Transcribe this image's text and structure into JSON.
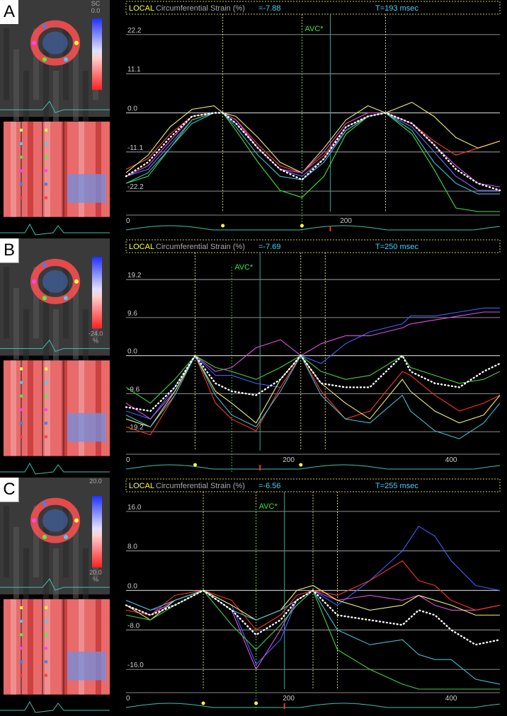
{
  "panels": [
    {
      "label": "A",
      "header": {
        "local": "LOCAL",
        "strain_label": "Circumferential Strain (%)",
        "strain_value": "=-7.88",
        "time_label": "T=193 msec"
      },
      "avc_label": "AVC*",
      "scale_top": "SC\n0.0",
      "chart_data": {
        "type": "line",
        "ylabel": "Circumferential Strain (%)",
        "yticks": [
          22.2,
          11.1,
          0.0,
          -11.1,
          -22.2
        ],
        "ytick_labels": [
          "22.2",
          "11.1",
          "0.0",
          "-11.1",
          "-22.2"
        ],
        "xticks": [
          0,
          200
        ],
        "ylim": [
          -28,
          28
        ],
        "xlim": [
          0,
          340
        ],
        "avc_x": 160,
        "markers_x": [
          88,
          160,
          236
        ],
        "x": [
          0,
          20,
          40,
          60,
          80,
          88,
          100,
          120,
          140,
          160,
          180,
          200,
          220,
          236,
          260,
          280,
          300,
          320,
          340
        ],
        "series": [
          {
            "color": "#7070ff",
            "values": [
              -18,
              -16,
              -9,
              -2,
              0,
              0,
              -3,
              -10,
              -16,
              -18,
              -13,
              -5,
              -1,
              0,
              -4,
              -11,
              -18,
              -22,
              -22
            ]
          },
          {
            "color": "#ff4040",
            "values": [
              -16,
              -13,
              -6,
              -1,
              0,
              0,
              -2,
              -9,
              -15,
              -17,
              -12,
              -4,
              -1,
              0,
              -3,
              -8,
              -12,
              -10,
              -8
            ]
          },
          {
            "color": "#f0f070",
            "values": [
              -17,
              -12,
              -4,
              1,
              2,
              0,
              -1,
              -7,
              -14,
              -17,
              -10,
              -2,
              2,
              0,
              3,
              -1,
              -7,
              -10,
              -8
            ]
          },
          {
            "color": "#40e040",
            "values": [
              -20,
              -18,
              -10,
              -2,
              0,
              0,
              -5,
              -14,
              -22,
              -24,
              -18,
              -6,
              -1,
              0,
              -6,
              -16,
              -27,
              -28,
              -28
            ]
          },
          {
            "color": "#e050e0",
            "values": [
              -18,
              -15,
              -8,
              -1,
              0,
              0,
              -2,
              -10,
              -16,
              -17,
              -11,
              -3,
              0,
              0,
              -3,
              -9,
              -15,
              -20,
              -21
            ]
          },
          {
            "color": "#40c0d0",
            "values": [
              -20,
              -17,
              -10,
              -3,
              0,
              0,
              -4,
              -12,
              -18,
              -19,
              -14,
              -5,
              -1,
              0,
              -5,
              -14,
              -20,
              -23,
              -23
            ]
          },
          {
            "color": "#ffffff",
            "dotted": true,
            "values": [
              -18,
              -14,
              -7,
              -1,
              0,
              0,
              -3,
              -10,
              -16,
              -19,
              -13,
              -4,
              -1,
              0,
              -3,
              -9,
              -16,
              -20,
              -22
            ]
          }
        ]
      }
    },
    {
      "label": "B",
      "header": {
        "local": "LOCAL",
        "strain_label": "Circumferential Strain (%)",
        "strain_value": "=-7.69",
        "time_label": "T=250 msec"
      },
      "avc_label": "AVC*",
      "scale_bottom": "-24.0\n%",
      "chart_data": {
        "type": "line",
        "ylabel": "Circumferential Strain (%)",
        "yticks": [
          19.2,
          9.6,
          0.0,
          -9.6,
          -19.2
        ],
        "ytick_labels": [
          "19.2",
          "9.6",
          "0.0",
          "-9.6",
          "-19.2"
        ],
        "xticks": [
          0,
          200,
          400
        ],
        "ylim": [
          -24,
          26
        ],
        "xlim": [
          0,
          460
        ],
        "avc_x": 130,
        "markers_x": [
          85,
          215,
          245
        ],
        "x": [
          0,
          30,
          60,
          85,
          110,
          130,
          160,
          190,
          215,
          240,
          270,
          300,
          340,
          350,
          380,
          410,
          440,
          460
        ],
        "series": [
          {
            "color": "#4060ff",
            "values": [
              -14,
              -16,
              -8,
              0,
              -5,
              -5,
              -7,
              -8,
              0,
              -2,
              3,
              6,
              8,
              10,
              10,
              11,
              12,
              12
            ]
          },
          {
            "color": "#e050e0",
            "values": [
              -12,
              -16,
              -9,
              0,
              -4,
              -3,
              2,
              4,
              0,
              3,
              5,
              5,
              7,
              8,
              9,
              10,
              11,
              11
            ]
          },
          {
            "color": "#ff3030",
            "values": [
              -18,
              -20,
              -10,
              0,
              -12,
              -16,
              -19,
              -8,
              0,
              -9,
              -16,
              -14,
              -4,
              -5,
              -10,
              -14,
              -12,
              -10
            ]
          },
          {
            "color": "#f0f070",
            "values": [
              -16,
              -18,
              -9,
              0,
              -9,
              -12,
              -17,
              -6,
              0,
              -7,
              -12,
              -16,
              -6,
              -9,
              -14,
              -17,
              -15,
              -10
            ]
          },
          {
            "color": "#40c0d0",
            "values": [
              -15,
              -18,
              -10,
              0,
              -10,
              -15,
              -18,
              -9,
              0,
              -10,
              -16,
              -17,
              -10,
              -14,
              -19,
              -21,
              -17,
              -12
            ]
          },
          {
            "color": "#40d040",
            "values": [
              -8,
              -12,
              -6,
              0,
              -3,
              -4,
              -6,
              -3,
              0,
              -4,
              -6,
              -5,
              0,
              -3,
              -5,
              -7,
              -6,
              -4
            ]
          },
          {
            "color": "#ffffff",
            "dotted": true,
            "values": [
              -13,
              -14,
              -8,
              0,
              -7,
              -9,
              -10,
              -6,
              0,
              -7,
              -8,
              -8,
              0,
              -4,
              -7,
              -8,
              -4,
              -2
            ]
          }
        ]
      }
    },
    {
      "label": "C",
      "header": {
        "local": "LOCAL",
        "strain_label": "Circumferential Strain (%)",
        "strain_value": "=-6.56",
        "time_label": "T=255 msec"
      },
      "avc_label": "AVC*",
      "scale_top": "20.0",
      "scale_bottom": "20.0\n%",
      "chart_data": {
        "type": "line",
        "ylabel": "Circumferential Strain (%)",
        "yticks": [
          16.0,
          8.0,
          0.0,
          -8.0,
          -16.0
        ],
        "ytick_labels": [
          "16.0",
          "8.0",
          "0.0",
          "-8.0",
          "-16.0"
        ],
        "xticks": [
          0,
          200,
          400
        ],
        "ylim": [
          -20,
          20
        ],
        "xlim": [
          0,
          460
        ],
        "avc_x": 160,
        "markers_x": [
          95,
          160,
          230,
          260
        ],
        "x": [
          0,
          30,
          60,
          95,
          130,
          160,
          190,
          210,
          230,
          260,
          300,
          340,
          360,
          380,
          400,
          430,
          460
        ],
        "series": [
          {
            "color": "#4060ff",
            "values": [
              -2,
              -4,
              -3,
              0,
              -3,
              -15,
              -10,
              -2,
              0,
              -3,
              2,
              8,
              13,
              11,
              6,
              1,
              0
            ]
          },
          {
            "color": "#e050e0",
            "values": [
              -3,
              -5,
              -2,
              0,
              -4,
              -16,
              -8,
              -2,
              0,
              -2,
              -1,
              -2,
              -1,
              -3,
              -4,
              -4,
              -3
            ]
          },
          {
            "color": "#ff3030",
            "values": [
              -4,
              -5,
              -1,
              0,
              -2,
              -8,
              -5,
              -1,
              0,
              -1,
              2,
              6,
              2,
              1,
              -2,
              -4,
              -3
            ]
          },
          {
            "color": "#f0f070",
            "values": [
              -3,
              -6,
              -2,
              0,
              -3,
              -6,
              -4,
              0,
              1,
              -2,
              -4,
              -3,
              -1,
              -2,
              -3,
              -5,
              -5
            ]
          },
          {
            "color": "#40c0d0",
            "values": [
              -2,
              -4,
              -2,
              0,
              -4,
              -6,
              -4,
              -2,
              0,
              -8,
              -11,
              -10,
              -13,
              -14,
              -14,
              -18,
              -19
            ]
          },
          {
            "color": "#40d040",
            "values": [
              -5,
              -6,
              -3,
              0,
              -7,
              -12,
              -7,
              -3,
              0,
              -12,
              -16,
              -19,
              -20,
              -20,
              -20,
              -20,
              -20
            ]
          },
          {
            "color": "#ffffff",
            "dotted": true,
            "values": [
              -3,
              -5,
              -3,
              0,
              -4,
              -9,
              -6,
              -2,
              0,
              -5,
              -6,
              -7,
              -4,
              -5,
              -8,
              -11,
              -10
            ]
          }
        ]
      }
    }
  ]
}
